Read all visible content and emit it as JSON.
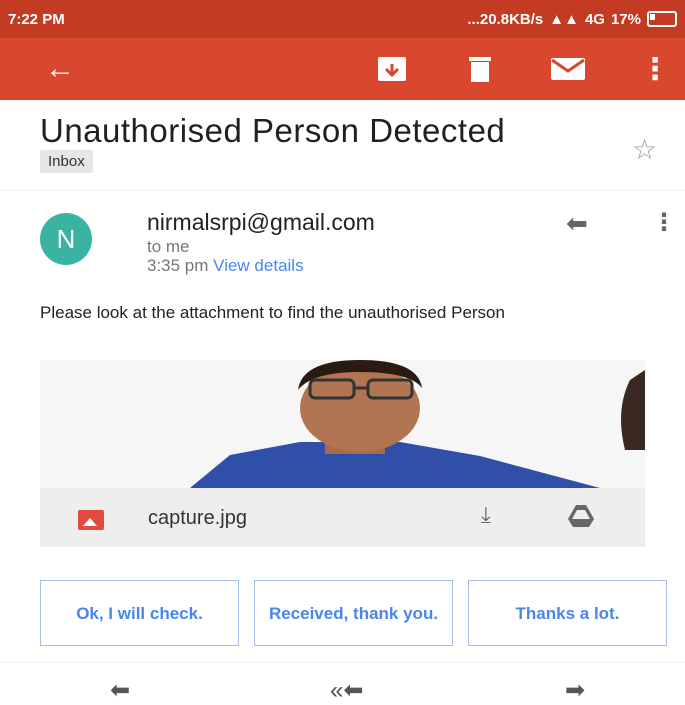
{
  "status_bar": {
    "time": "7:22 PM",
    "network_speed": "...20.8KB/s",
    "network": "4G",
    "battery": "17%"
  },
  "app_bar": {
    "icons": [
      "back-arrow-icon",
      "archive-icon",
      "delete-icon",
      "mail-icon",
      "more-vert-icon"
    ],
    "accent_color": "#d9472f",
    "status_color": "#c23b22"
  },
  "email": {
    "subject": "Unauthorised Person Detected",
    "label": "Inbox",
    "sender": {
      "avatar_letter": "N",
      "address": "nirmalsrpi@gmail.com",
      "recipient": "to me",
      "time": "3:35 pm",
      "details_link": "View details"
    },
    "body": "Please look at the attachment to find the unauthorised Person",
    "attachment": {
      "filename": "capture.jpg"
    }
  },
  "smart_replies": [
    "Ok, I will check.",
    "Received, thank you.",
    "Thanks a lot."
  ],
  "bottom_actions": [
    "reply-icon",
    "reply-all-icon",
    "forward-icon"
  ]
}
